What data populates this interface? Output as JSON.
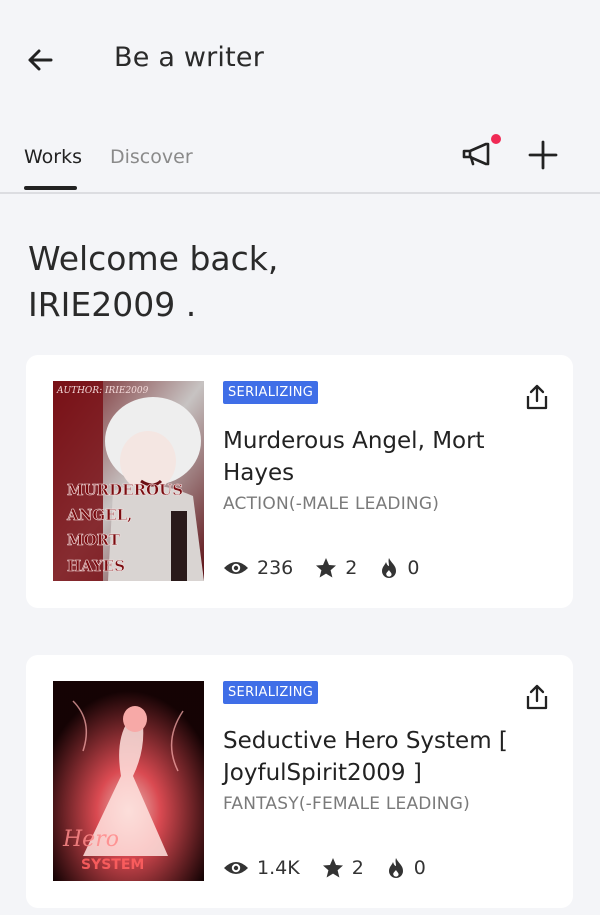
{
  "header": {
    "title": "Be a writer"
  },
  "tabs": [
    {
      "label": "Works",
      "active": true
    },
    {
      "label": "Discover",
      "active": false
    }
  ],
  "welcome": {
    "line1": "Welcome back,",
    "line2": "IRIE2009 ."
  },
  "books": [
    {
      "status": "SERIALIZING",
      "title": "Murderous Angel, Mort Hayes",
      "genre": "ACTION(-MALE LEADING)",
      "views": "236",
      "stars": "2",
      "fire": "0",
      "cover": {
        "lettering": "MURDEROUS ANGEL, MORT HAYES",
        "author_text": "AUTHOR: IRIE2009"
      }
    },
    {
      "status": "SERIALIZING",
      "title": "Seductive Hero System [ JoyfulSpirit2009 ]",
      "genre": "FANTASY(-FEMALE LEADING)",
      "views": "1.4K",
      "stars": "2",
      "fire": "0",
      "cover": {
        "lettering": "Hero SYSTEM"
      }
    }
  ],
  "colors": {
    "accent_badge": "#3f6ee7",
    "notification_dot": "#f02a55",
    "background": "#f4f5f8"
  },
  "icons": [
    "back-arrow-icon",
    "megaphone-icon",
    "plus-icon",
    "share-icon",
    "eye-icon",
    "star-icon",
    "fire-icon"
  ]
}
